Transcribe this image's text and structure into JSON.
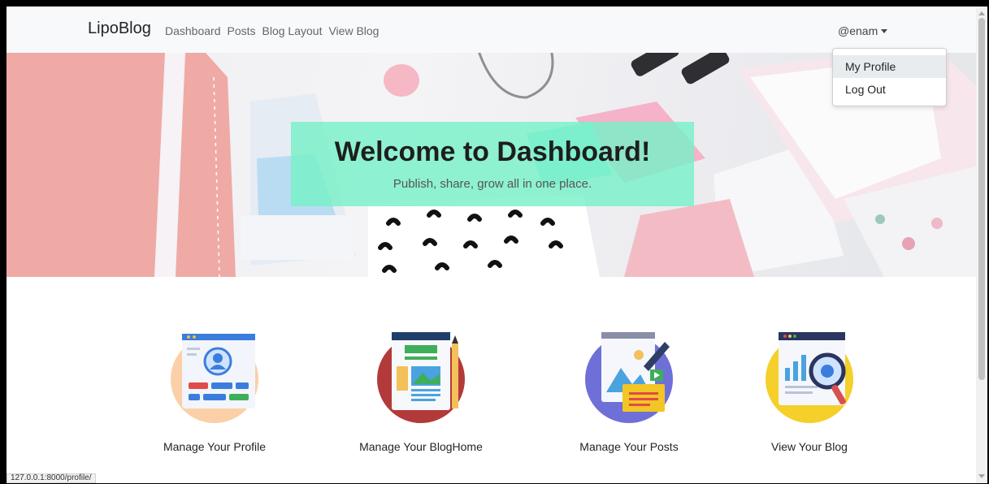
{
  "navbar": {
    "brand": "LipoBlog",
    "links": [
      "Dashboard",
      "Posts",
      "Blog Layout",
      "View Blog"
    ],
    "user": "@enam"
  },
  "dropdown": {
    "items": [
      "My Profile",
      "Log Out"
    ]
  },
  "hero": {
    "title": "Welcome to Dashboard!",
    "subtitle": "Publish, share, grow all in one place.",
    "accent_color": "#78F0C8"
  },
  "features": [
    {
      "label": "Manage Your Profile",
      "icon": "profile-illustration-icon"
    },
    {
      "label": "Manage Your BlogHome",
      "icon": "bloghome-illustration-icon"
    },
    {
      "label": "Manage Your Posts",
      "icon": "posts-illustration-icon"
    },
    {
      "label": "View Your Blog",
      "icon": "view-blog-illustration-icon"
    }
  ],
  "status_url": "127.0.0.1:8000/profile/"
}
